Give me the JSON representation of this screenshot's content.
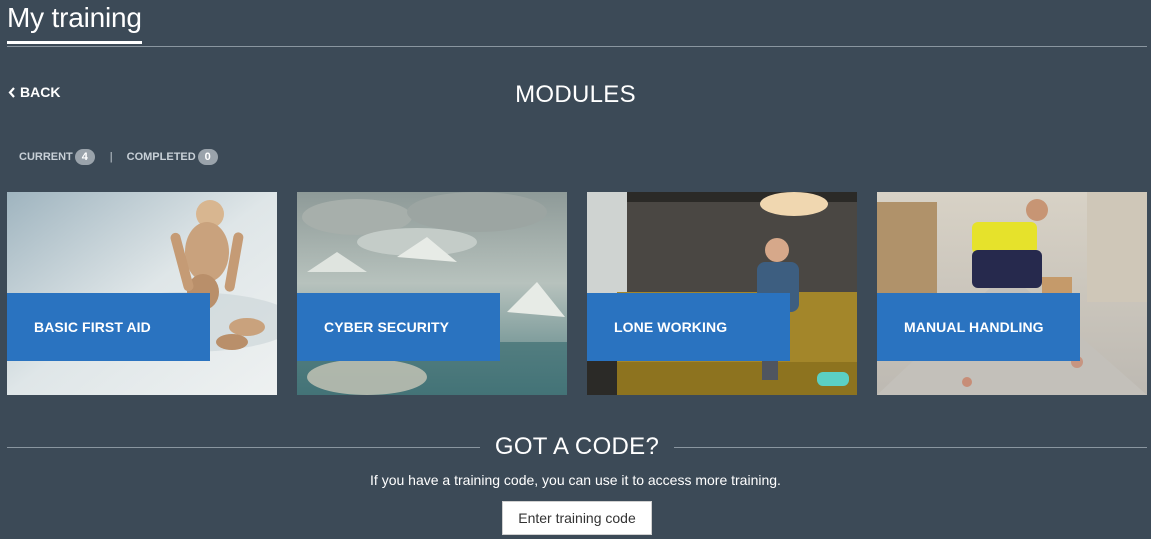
{
  "header": {
    "title": "My training"
  },
  "nav": {
    "back_label": "BACK"
  },
  "modules": {
    "title": "MODULES",
    "filters": {
      "current_label": "CURRENT",
      "current_count": "4",
      "separator": "|",
      "completed_label": "COMPLETED",
      "completed_count": "0"
    },
    "cards": [
      {
        "label": "BASIC FIRST AID"
      },
      {
        "label": "CYBER SECURITY"
      },
      {
        "label": "LONE WORKING"
      },
      {
        "label": "MANUAL HANDLING"
      }
    ]
  },
  "code": {
    "heading": "GOT A CODE?",
    "description": "If you have a training code, you can use it to access more training.",
    "button_label": "Enter training code"
  },
  "colors": {
    "background": "#3c4a57",
    "card_label": "#2a73c0",
    "badge": "#9aa3ab"
  }
}
